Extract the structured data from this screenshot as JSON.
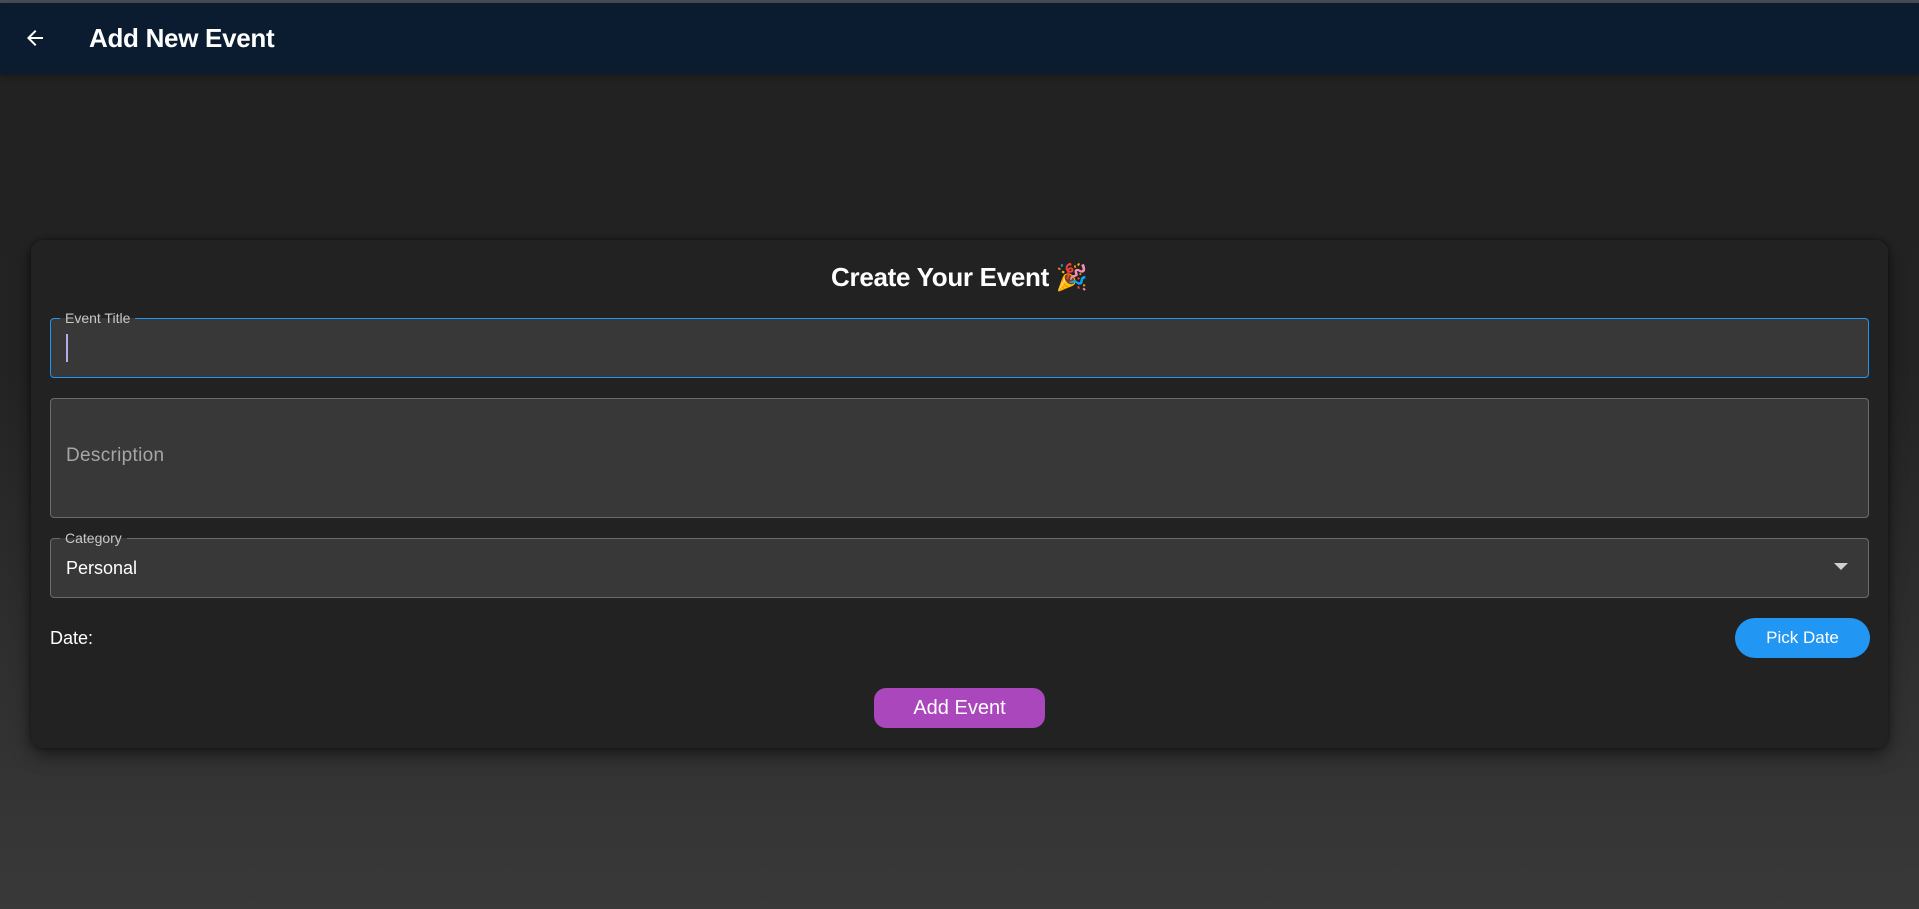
{
  "appbar": {
    "title": "Add New Event",
    "back_icon": "arrow-left-icon"
  },
  "form": {
    "heading": "Create Your Event 🎉",
    "title_field": {
      "label": "Event Title",
      "value": ""
    },
    "description_field": {
      "placeholder": "Description",
      "value": ""
    },
    "category_field": {
      "label": "Category",
      "selected": "Personal",
      "dropdown_icon": "caret-down-icon"
    },
    "date": {
      "label": "Date:",
      "pick_button": "Pick Date"
    },
    "submit_button": "Add Event"
  },
  "colors": {
    "appbar_bg": "#0b1c31",
    "page_bg": "#222222",
    "field_bg": "#383838",
    "focus_border": "#2196f3",
    "pick_date_bg": "#2196f3",
    "add_event_bg": "#ab47bc"
  }
}
